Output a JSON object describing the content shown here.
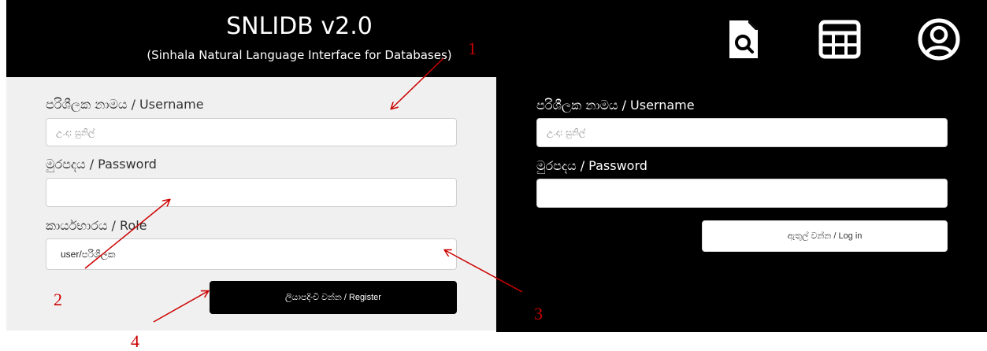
{
  "header": {
    "title": "SNLIDB v2.0",
    "subtitle": "(Sinhala Natural Language Interface for Databases)",
    "icons": [
      "document-search-icon",
      "table-grid-icon",
      "user-profile-icon"
    ]
  },
  "register": {
    "username_label": "පරිශීලක නාමය / Username",
    "username_placeholder": "උ.දා: සුනිල්",
    "password_label": "මුරපදය / Password",
    "role_label": "කාර්යභාරය / Role",
    "role_value": "user/පරිශීලක",
    "register_button": "ලියාපදිංචි වන්න / Register"
  },
  "login": {
    "username_label": "පරිශීලක නාමය / Username",
    "username_placeholder": "උ.දා: සුනිල්",
    "password_label": "මුරපදය / Password",
    "login_button": "ඇතුල් වන්න / Log in"
  },
  "annotations": {
    "label_1": "1",
    "label_2": "2",
    "label_3": "3",
    "label_4": "4",
    "color": "#cc0000"
  },
  "colors": {
    "header_bg": "#000000",
    "register_bg": "#f0f0f0",
    "login_bg": "#000000"
  }
}
